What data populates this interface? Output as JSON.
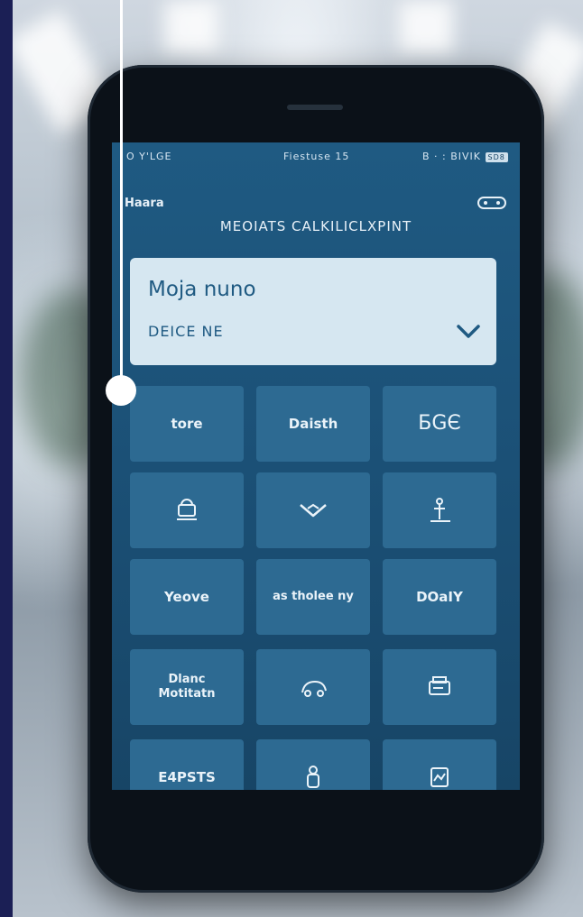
{
  "status_bar": {
    "left": "O Y'LGE",
    "center": "Fiestuse 15",
    "right": "B · : BIVIK",
    "badge": "SD8"
  },
  "header": {
    "left_label": "Haara",
    "title": "MEOIATS CALKILICLXPINT",
    "icon": "controller-icon"
  },
  "select": {
    "value": "Moja nuno",
    "sub_label": "DEICE NE",
    "chevron": "chevron-down-icon"
  },
  "tiles": [
    {
      "label": "tore",
      "icon": null
    },
    {
      "label": "Daisth",
      "icon": null
    },
    {
      "label": "БGЄ",
      "icon": null
    },
    {
      "label": null,
      "icon": "basket-icon"
    },
    {
      "label": null,
      "icon": "check-wave-icon"
    },
    {
      "label": null,
      "icon": "plant-stand-icon"
    },
    {
      "label": "Yeove",
      "icon": null
    },
    {
      "label": "as tholee ny",
      "icon": null
    },
    {
      "label": "DOaIY",
      "icon": null
    },
    {
      "label": "Dlanc Motitatn",
      "icon": null
    },
    {
      "label": null,
      "icon": "vehicle-icon"
    },
    {
      "label": null,
      "icon": "printer-icon"
    },
    {
      "label": "E4PSTS",
      "icon": null
    },
    {
      "label": null,
      "icon": "person-icon"
    },
    {
      "label": null,
      "icon": "document-icon"
    }
  ],
  "colors": {
    "screen": "#1f5a82",
    "tile": "#2d6a92",
    "card": "#d6e7f1",
    "frame": "#1b1f55"
  }
}
